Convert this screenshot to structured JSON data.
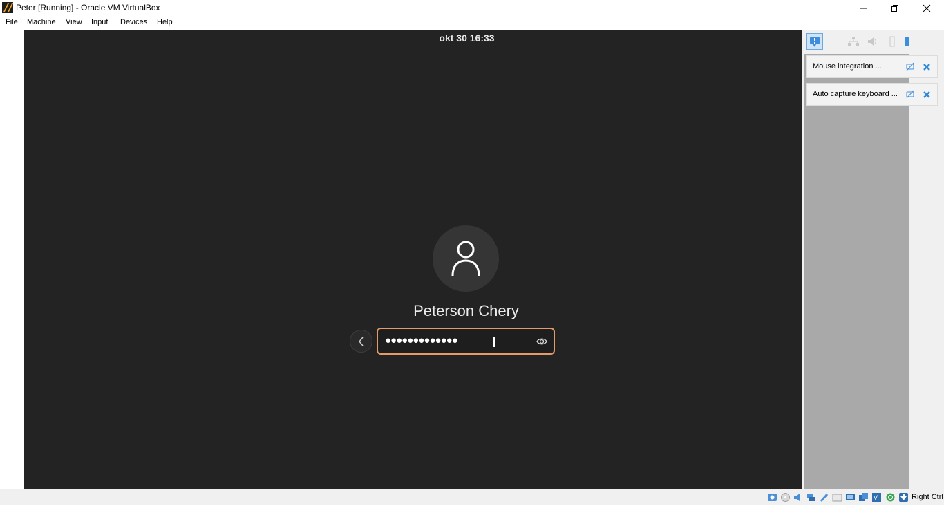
{
  "window": {
    "title": "Peter [Running] - Oracle VM VirtualBox",
    "app_icon": "virtualbox-icon",
    "controls": [
      "minimize-icon",
      "maximize-icon",
      "close-icon"
    ]
  },
  "menu": {
    "items": [
      {
        "label": "File"
      },
      {
        "label": "Machine"
      },
      {
        "label": "View"
      },
      {
        "label": "Input"
      },
      {
        "label": "Devices"
      },
      {
        "label": "Help"
      }
    ]
  },
  "vm": {
    "clock": "okt 30  16:33",
    "username": "Peterson Chery",
    "password_masked": "●●●●●●●●●●●●●",
    "back_icon": "chevron-left-icon",
    "reveal_icon": "eye-icon",
    "avatar_icon": "user-icon"
  },
  "notifications": {
    "items": [
      {
        "text": "Mouse integration ..."
      },
      {
        "text": "Auto capture keyboard ..."
      }
    ]
  },
  "statusbar": {
    "host_key": "Right Ctrl"
  },
  "colors": {
    "vm_background": "#232323",
    "password_border": "#e59a6b",
    "panel_list": "#a9a9a9"
  }
}
